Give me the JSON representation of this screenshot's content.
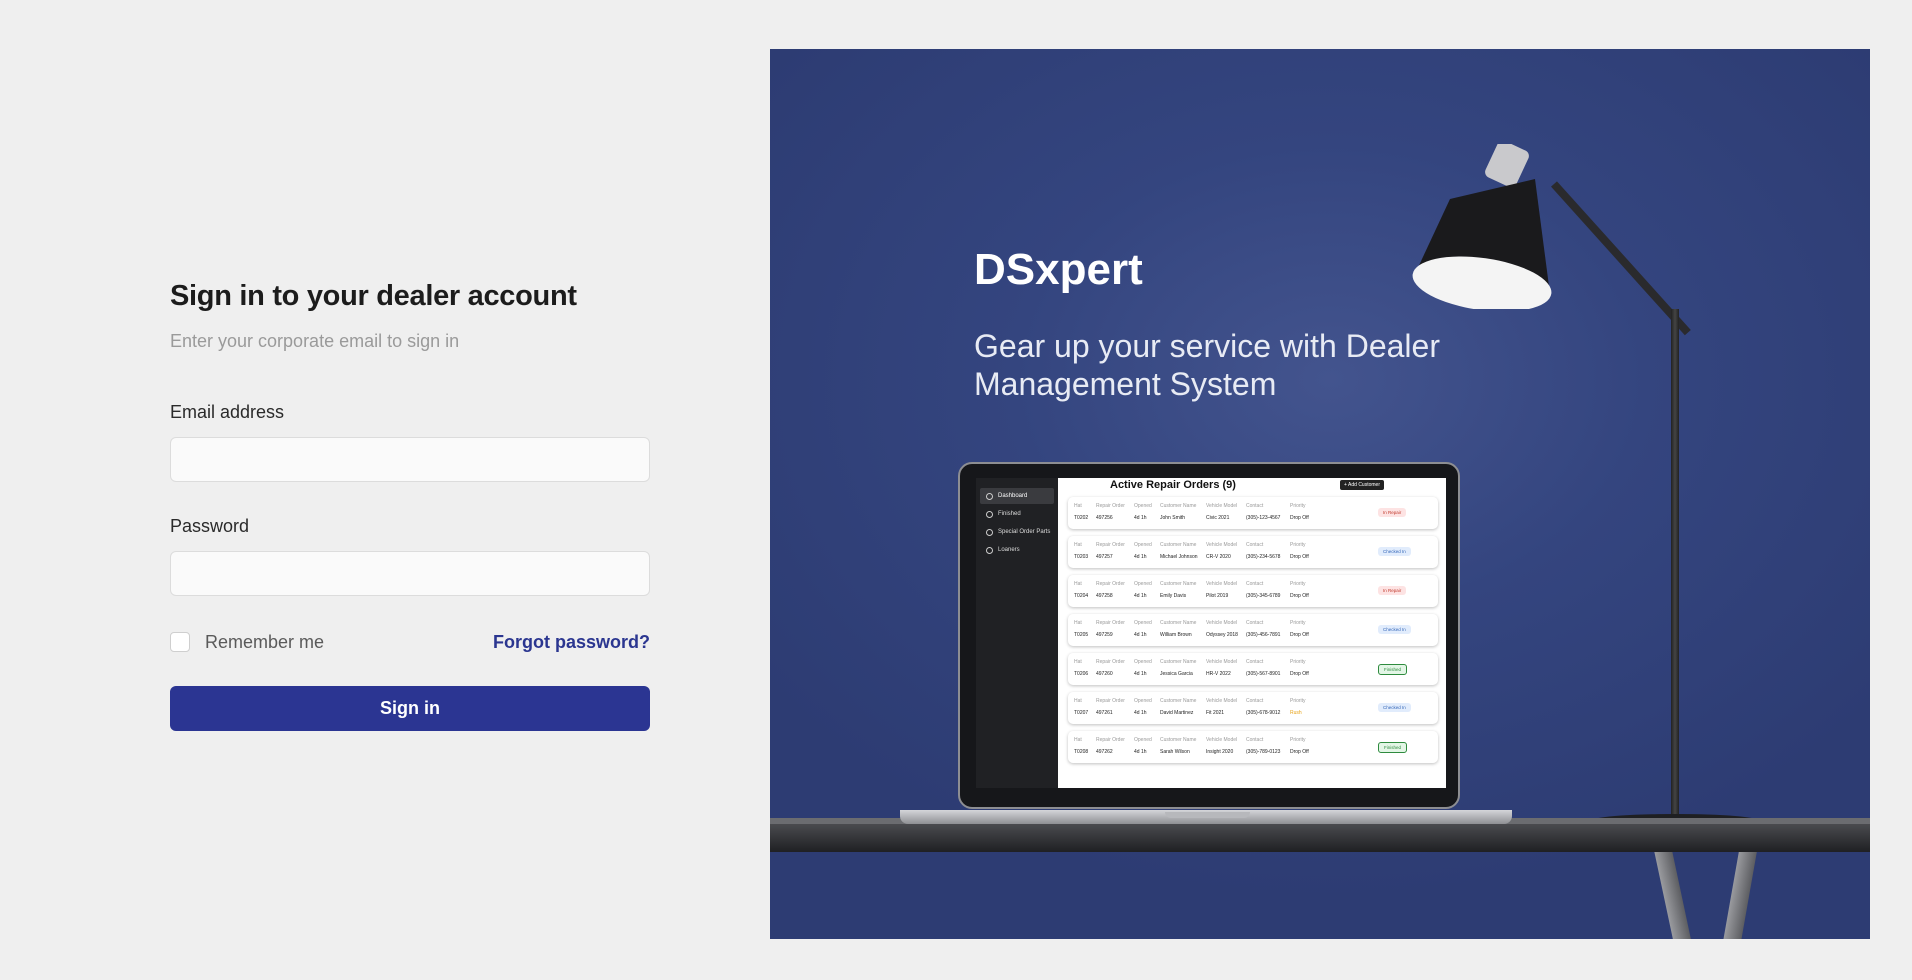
{
  "form": {
    "title": "Sign in to your dealer account",
    "subtitle": "Enter your corporate email to sign in",
    "email_label": "Email address",
    "email_value": "",
    "password_label": "Password",
    "password_value": "",
    "remember_label": "Remember me",
    "forgot_label": "Forgot password?",
    "signin_label": "Sign in"
  },
  "hero": {
    "brand": "DSxpert",
    "tagline": "Gear up your service with Dealer Management System"
  },
  "app": {
    "title": "Active Repair Orders (9)",
    "add_button": "+ Add Customer",
    "nav": [
      "Dashboard",
      "Finished",
      "Special Order Parts",
      "Loaners"
    ],
    "columns": [
      "Hat",
      "Repair Order",
      "Opened",
      "Customer Name",
      "Vehicle Model",
      "Contact",
      "Priority"
    ],
    "rows": [
      {
        "hat": "T0202",
        "ro": "497256",
        "opened": "4d 1h",
        "name": "John Smith",
        "model": "Civic 2021",
        "contact": "(305)-123-4567",
        "priority": "Drop Off",
        "status": "In Repair"
      },
      {
        "hat": "T0203",
        "ro": "497257",
        "opened": "4d 1h",
        "name": "Michael Johnson",
        "model": "CR-V 2020",
        "contact": "(305)-234-5678",
        "priority": "Drop Off",
        "status": "Checked In"
      },
      {
        "hat": "T0204",
        "ro": "497258",
        "opened": "4d 1h",
        "name": "Emily Davis",
        "model": "Pilot 2019",
        "contact": "(305)-345-6789",
        "priority": "Drop Off",
        "status": "In Repair"
      },
      {
        "hat": "T0205",
        "ro": "497259",
        "opened": "4d 1h",
        "name": "William Brown",
        "model": "Odyssey 2018",
        "contact": "(305)-456-7891",
        "priority": "Drop Off",
        "status": "Checked In"
      },
      {
        "hat": "T0206",
        "ro": "497260",
        "opened": "4d 1h",
        "name": "Jessica Garcia",
        "model": "HR-V 2022",
        "contact": "(305)-567-8901",
        "priority": "Drop Off",
        "status": "Finished"
      },
      {
        "hat": "T0207",
        "ro": "497261",
        "opened": "4d 1h",
        "name": "David Martinez",
        "model": "Fit 2021",
        "contact": "(305)-678-9012",
        "priority": "Rush",
        "status": "Checked In"
      },
      {
        "hat": "T0208",
        "ro": "497262",
        "opened": "4d 1h",
        "name": "Sarah Wilson",
        "model": "Insight 2020",
        "contact": "(305)-789-0123",
        "priority": "Drop Off",
        "status": "Finished"
      }
    ]
  },
  "colors": {
    "primary": "#2b3592",
    "link": "#2b3690",
    "hero_bg": "#34457f",
    "background": "#efefef"
  }
}
